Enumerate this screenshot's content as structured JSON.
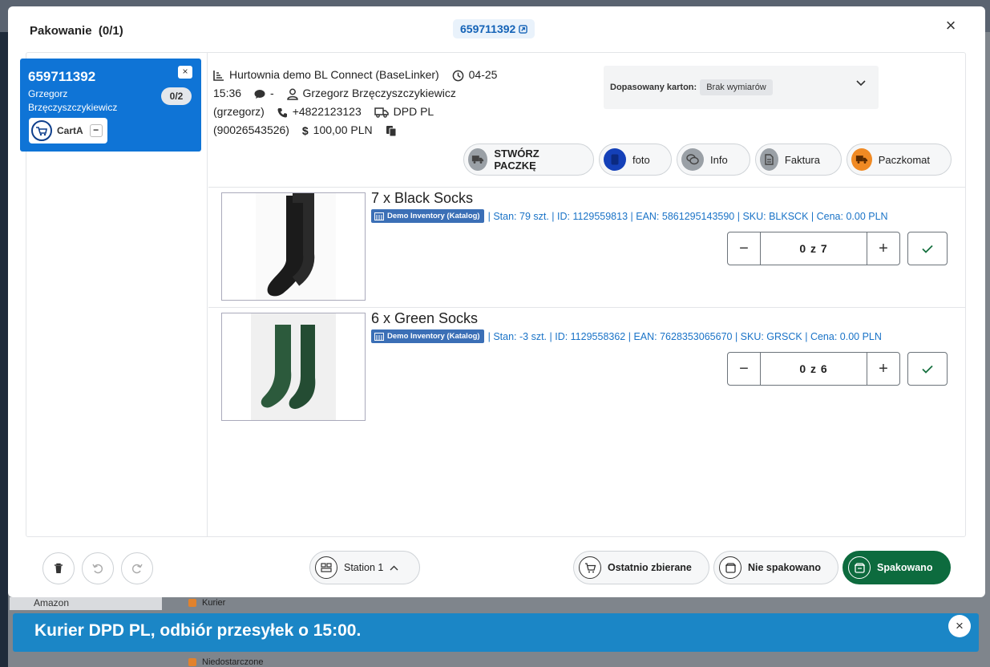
{
  "background": {
    "select_value": "Amazon",
    "rows": [
      "Kurier",
      "Niedostarczone"
    ]
  },
  "modal": {
    "title": "Pakowanie",
    "progress": "(0/1)",
    "order_link": "659711392",
    "close_label": "×"
  },
  "order_card": {
    "number": "659711392",
    "customer_first": "Grzegorz",
    "customer_last": "Brzęczyszczykiewicz",
    "close_label": "×",
    "count": "0/2",
    "cart_label": "CartA",
    "cart_minus": "−"
  },
  "info": {
    "source": "Hurtownia demo BL Connect (BaseLinker)",
    "date": "04-25",
    "time": "15:36",
    "comment": "-",
    "customer": "Grzegorz Brzęczyszczykiewicz",
    "login": "(grzegorz)",
    "phone": "+4822123123",
    "courier": "DPD PL",
    "tracking": "(90026543526)",
    "amount": "100,00 PLN"
  },
  "karton": {
    "label": "Dopasowany karton:",
    "value": "Brak wymiarów"
  },
  "actions": [
    {
      "label": "STWÓRZ PACZKĘ",
      "color": "#9aa0a6"
    },
    {
      "label": "foto",
      "color": "#1440b8"
    },
    {
      "label": "Info",
      "color": "#9aa0a6"
    },
    {
      "label": "Faktura",
      "color": "#9aa0a6"
    },
    {
      "label": "Paczkomat",
      "color": "#f08a24"
    }
  ],
  "items": [
    {
      "title": "7 x Black Socks",
      "inventory": "Demo Inventory (Katalog)",
      "details": "| Stan: 79 szt. | ID: 1129559813 | EAN: 5861295143590 | SKU: BLKSCK | Cena: 0.00 PLN",
      "qty": "0 z 7",
      "sock_color": "#1b1b1b"
    },
    {
      "title": "6 x Green Socks",
      "inventory": "Demo Inventory (Katalog)",
      "details": "| Stan: -3 szt. | ID: 1129558362 | EAN: 7628353065670 | SKU: GRSCK | Cena: 0.00 PLN",
      "qty": "0 z 6",
      "sock_color": "#2c5a3c"
    }
  ],
  "footer": {
    "station": "Station 1",
    "recent": "Ostatnio zbierane",
    "not_packed": "Nie spakowano",
    "packed": "Spakowano"
  },
  "toast": {
    "message": "Kurier DPD PL, odbiór przesyłek o 15:00.",
    "close_label": "×"
  }
}
